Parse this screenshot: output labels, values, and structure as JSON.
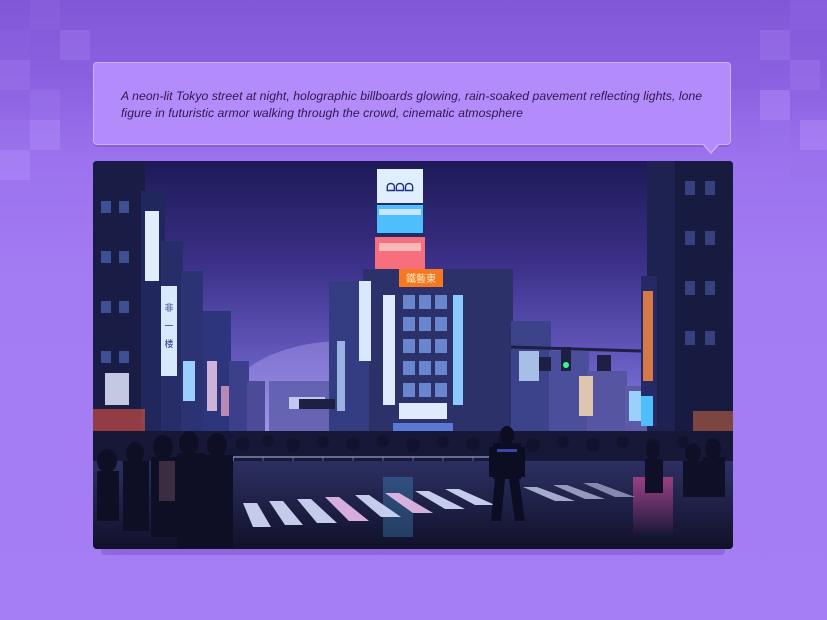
{
  "prompt": {
    "text": "A neon-lit Tokyo street at night, holographic billboards glowing, rain-soaked pavement reflecting lights, lone figure in futuristic armor walking through the crowd, cinematic atmosphere"
  },
  "colors": {
    "background": "#a57df4",
    "bubble": "#b48bfb",
    "bubble_border": "#cfaffe",
    "prompt_text": "#2c1a4d",
    "neon_blue": "#4fc3ff",
    "neon_pink": "#ff4fa3",
    "sky": "#3a2a7a"
  },
  "icons": {
    "bubble_tail": "speech-tail-icon"
  }
}
